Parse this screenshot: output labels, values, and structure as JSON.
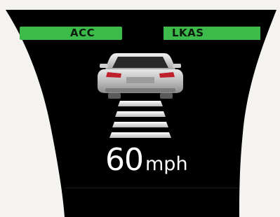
{
  "indicators": {
    "acc": {
      "label": "ACC",
      "status": "active",
      "color": "#3dbb4a"
    },
    "lkas": {
      "label": "LKAS",
      "status": "active",
      "color": "#3dbb4a"
    }
  },
  "icons": {
    "lead_vehicle": "car-rear-icon",
    "following_distance": "distance-bars-icon"
  },
  "following_distance": {
    "bars": 4
  },
  "speed": {
    "value": "60",
    "unit": "mph"
  },
  "colors": {
    "screen": "#000000",
    "indicator": "#3dbb4a",
    "text": "#ffffff",
    "surround": "#f4f3f0"
  }
}
